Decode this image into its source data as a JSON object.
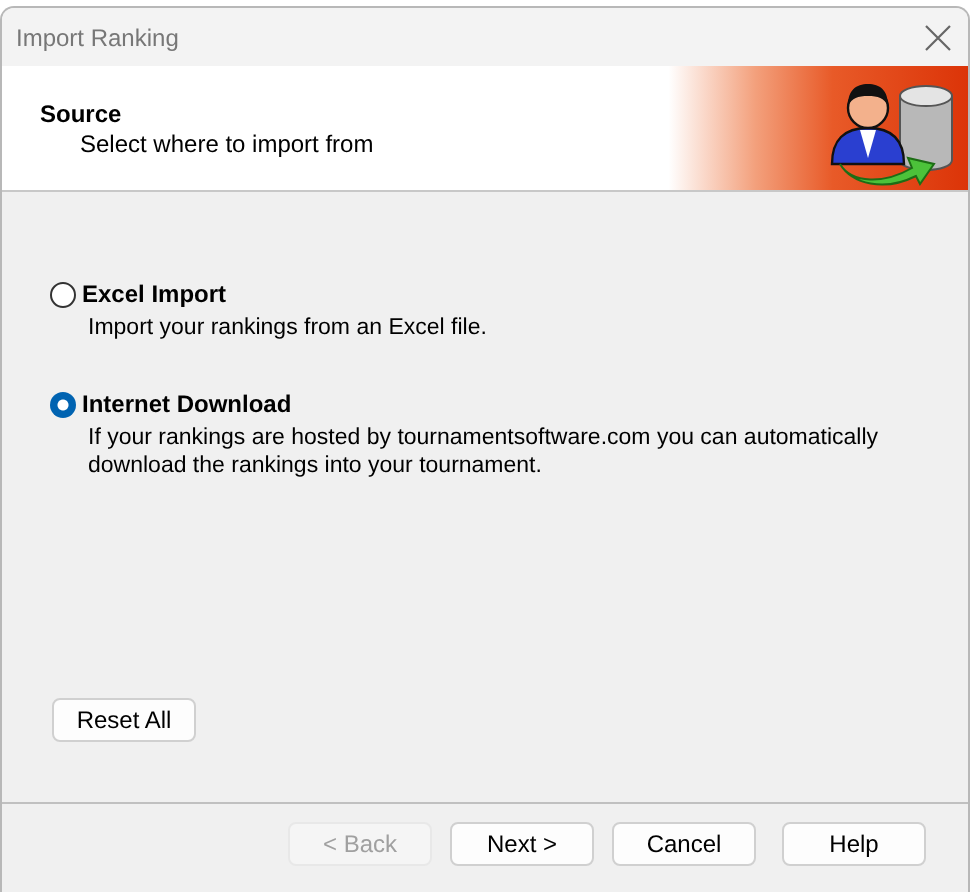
{
  "window": {
    "title": "Import Ranking"
  },
  "header": {
    "title": "Source",
    "subtitle": "Select where to import from"
  },
  "options": [
    {
      "label": "Excel Import",
      "description": "Import your rankings from an Excel file.",
      "selected": false
    },
    {
      "label": "Internet Download",
      "description": "If your rankings are hosted by tournamentsoftware.com you can automatically download the rankings into your tournament.",
      "selected": true
    }
  ],
  "reset_button": "Reset All",
  "buttons": [
    {
      "label": "< Back",
      "disabled": true
    },
    {
      "label": "Next >",
      "disabled": false
    },
    {
      "label": "Cancel",
      "disabled": false
    },
    {
      "label": "Help",
      "disabled": false
    }
  ]
}
